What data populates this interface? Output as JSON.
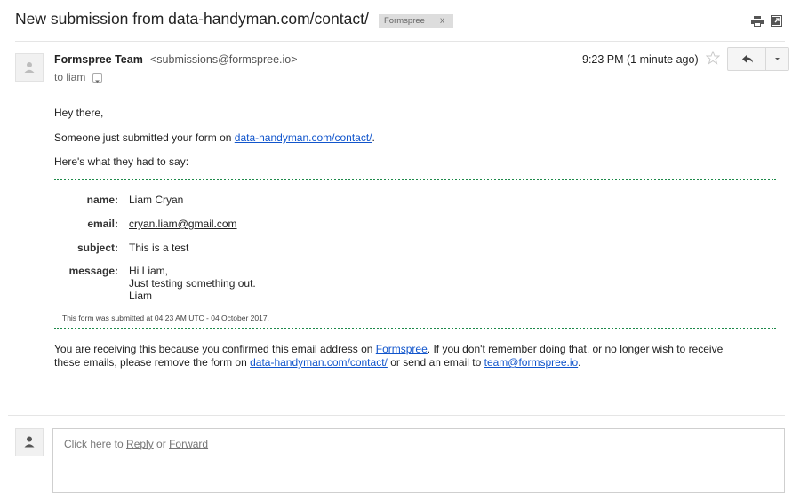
{
  "header": {
    "subject": "New submission from data-handyman.com/contact/",
    "label": "Formspree",
    "label_remove": "x",
    "print_icon": "print-icon",
    "new_window_icon": "open-in-new-window-icon"
  },
  "message": {
    "sender_name": "Formspree Team",
    "sender_email": "<submissions@formspree.io>",
    "to_text": "to liam",
    "timestamp": "9:23 PM (1 minute ago)",
    "greeting": "Hey there,",
    "intro_prefix": "Someone just submitted your form on ",
    "intro_link": "data-handyman.com/contact/",
    "intro_suffix": ".",
    "lead": "Here's what they had to say:",
    "fields": {
      "name_label": "name:",
      "name_value": "Liam Cryan",
      "email_label": "email:",
      "email_value": "cryan.liam@gmail.com",
      "subject_label": "subject:",
      "subject_value": "This is a test",
      "message_label": "message:",
      "message_line1": "Hi Liam,",
      "message_line2": "Just testing something out.",
      "message_line3": "Liam"
    },
    "submitted_note": "This form was submitted at 04:23 AM UTC - 04 October 2017.",
    "footer": {
      "p1": "You are receiving this because you confirmed this email address on ",
      "link1": "Formspree",
      "p2": ". If you don't remember doing that, or no longer wish to receive",
      "p3": "these emails, please remove the form on ",
      "link2": "data-handyman.com/contact/",
      "p4": " or send an email to ",
      "link3": "team@formspree.io",
      "p5": "."
    }
  },
  "reply": {
    "prefix": "Click here to ",
    "reply_link": "Reply",
    "or": " or ",
    "forward_link": "Forward"
  },
  "colors": {
    "link": "#1155cc",
    "divider_dotted": "#1e8a4a",
    "label_chip": "#dddddd"
  }
}
